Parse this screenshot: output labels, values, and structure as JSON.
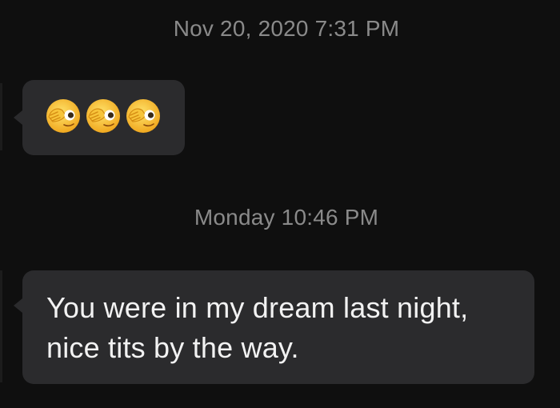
{
  "thread": {
    "messages": [
      {
        "timestamp": "Nov 20, 2020 7:31 PM",
        "emojis": [
          "face-peeking-icon",
          "face-peeking-icon",
          "face-peeking-icon"
        ]
      },
      {
        "timestamp": "Monday 10:46 PM",
        "text_line1": "You were in my dream last night,",
        "text_line2": "nice tits by the way."
      }
    ]
  },
  "colors": {
    "background": "#0f0f0f",
    "bubble": "#2b2b2d",
    "timestamp_text": "#8a8a8a",
    "message_text": "#f2f2f2",
    "emoji_face": "#f5c233"
  }
}
